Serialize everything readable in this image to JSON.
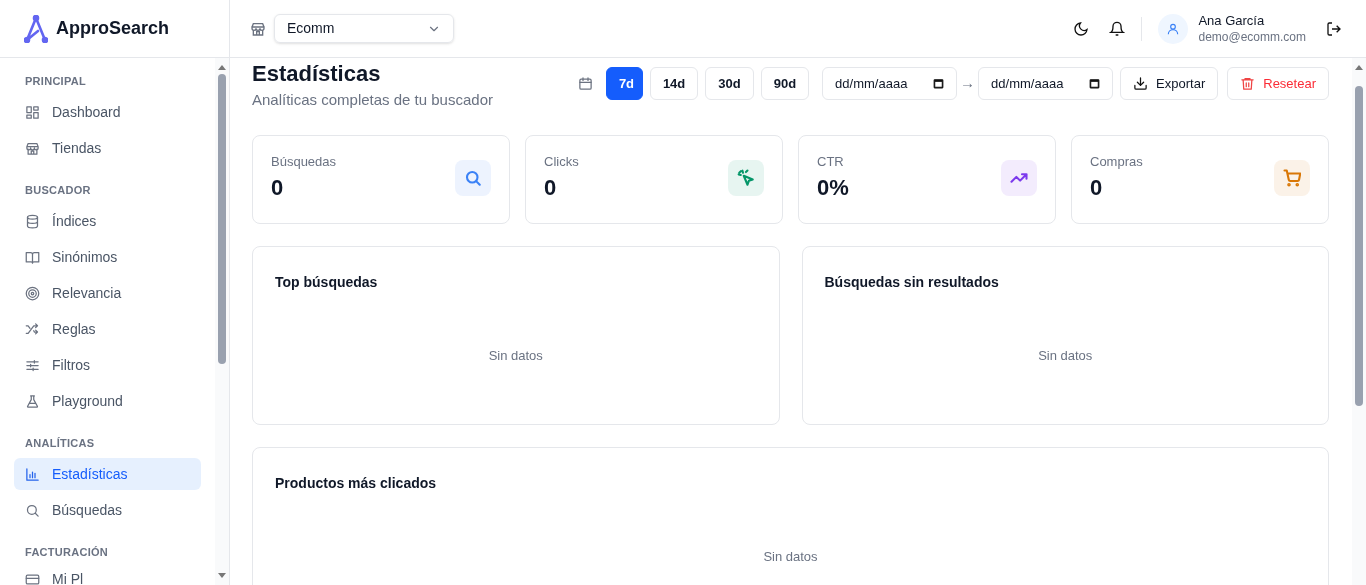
{
  "brand": {
    "name": "ApproSearch"
  },
  "store_selector": {
    "value": "Ecomm"
  },
  "user": {
    "name": "Ana García",
    "email": "demo@ecomm.com"
  },
  "sidebar": {
    "sections": [
      {
        "title": "PRINCIPAL",
        "items": [
          {
            "label": "Dashboard",
            "selected": false
          },
          {
            "label": "Tiendas",
            "selected": false
          }
        ]
      },
      {
        "title": "BUSCADOR",
        "items": [
          {
            "label": "Índices",
            "selected": false
          },
          {
            "label": "Sinónimos",
            "selected": false
          },
          {
            "label": "Relevancia",
            "selected": false
          },
          {
            "label": "Reglas",
            "selected": false
          },
          {
            "label": "Filtros",
            "selected": false
          },
          {
            "label": "Playground",
            "selected": false
          }
        ]
      },
      {
        "title": "ANALÍTICAS",
        "items": [
          {
            "label": "Estadísticas",
            "selected": true
          },
          {
            "label": "Búsquedas",
            "selected": false
          }
        ]
      },
      {
        "title": "FACTURACIÓN",
        "items": [
          {
            "label": "Mi Pl",
            "selected": false
          }
        ]
      }
    ]
  },
  "page": {
    "title": "Estadísticas",
    "subtitle": "Analíticas completas de tu buscador"
  },
  "periods": [
    {
      "label": "7d",
      "selected": true
    },
    {
      "label": "14d",
      "selected": false
    },
    {
      "label": "30d",
      "selected": false
    },
    {
      "label": "90d",
      "selected": false
    }
  ],
  "date_from": {
    "placeholder": "dd/mm/aaaa"
  },
  "range_separator": "→",
  "date_to": {
    "placeholder": "dd/mm/aaaa"
  },
  "actions": [
    {
      "label": "Exportar",
      "kind": "export"
    },
    {
      "label": "Resetear",
      "kind": "reset"
    }
  ],
  "stats": [
    {
      "label": "Búsquedas",
      "value": "0",
      "kind": "search",
      "color": "#3b82f6"
    },
    {
      "label": "Clicks",
      "value": "0",
      "kind": "click",
      "color": "#059669"
    },
    {
      "label": "CTR",
      "value": "0%",
      "kind": "trend",
      "color": "#7c3aed"
    },
    {
      "label": "Compras",
      "value": "0",
      "kind": "cart",
      "color": "#d97706"
    }
  ],
  "panels": [
    {
      "title": "Top búsquedas",
      "empty": "Sin datos"
    },
    {
      "title": "Búsquedas sin resultados",
      "empty": "Sin datos"
    },
    {
      "title": "Productos más clicados",
      "empty": "Sin datos"
    }
  ]
}
